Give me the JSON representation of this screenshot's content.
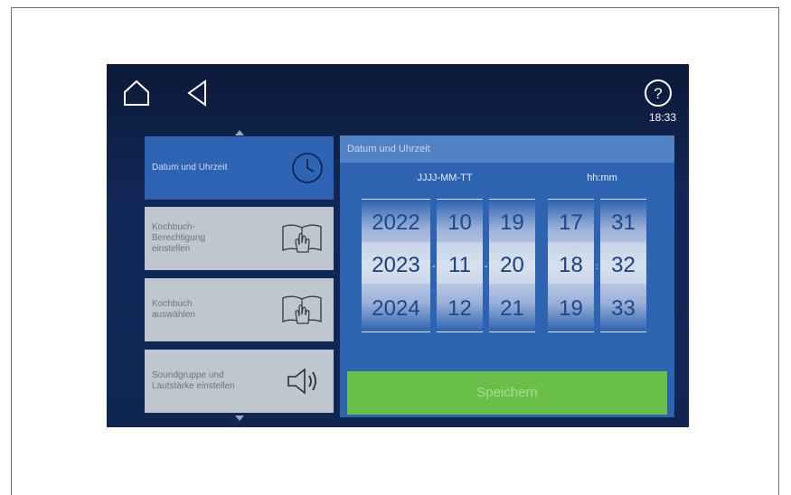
{
  "topbar": {
    "time": "18:33",
    "icons": [
      "home-icon",
      "back-icon",
      "help-icon"
    ]
  },
  "menu": {
    "items": [
      {
        "label": "Datum und Uhrzeit",
        "icon": "clock-icon",
        "active": true
      },
      {
        "label": "Kochbuch-\nBerechtigung\neinstellen",
        "icon": "book-hand-icon",
        "active": false
      },
      {
        "label": "Kochbuch\nauswählen",
        "icon": "book-hand-icon",
        "active": false
      },
      {
        "label": "Soundgruppe und\nLautstärke einstellen",
        "icon": "speaker-icon",
        "active": false
      }
    ]
  },
  "panel": {
    "title": "Datum und Uhrzeit",
    "date_format": "JJJJ-MM-TT",
    "time_format": "hh:mm",
    "wheels": {
      "year": {
        "prev": "2022",
        "current": "2023",
        "next": "2024"
      },
      "month": {
        "prev": "10",
        "current": "11",
        "next": "12"
      },
      "day": {
        "prev": "19",
        "current": "20",
        "next": "21"
      },
      "hour": {
        "prev": "17",
        "current": "18",
        "next": "19"
      },
      "minute": {
        "prev": "31",
        "current": "32",
        "next": "33"
      }
    },
    "date_separator": "-",
    "time_separator": ":",
    "save_label": "Speichern"
  },
  "colors": {
    "accent": "#2d63b0",
    "save": "#6abf4b",
    "menu_inactive": "#bdc7cd"
  }
}
